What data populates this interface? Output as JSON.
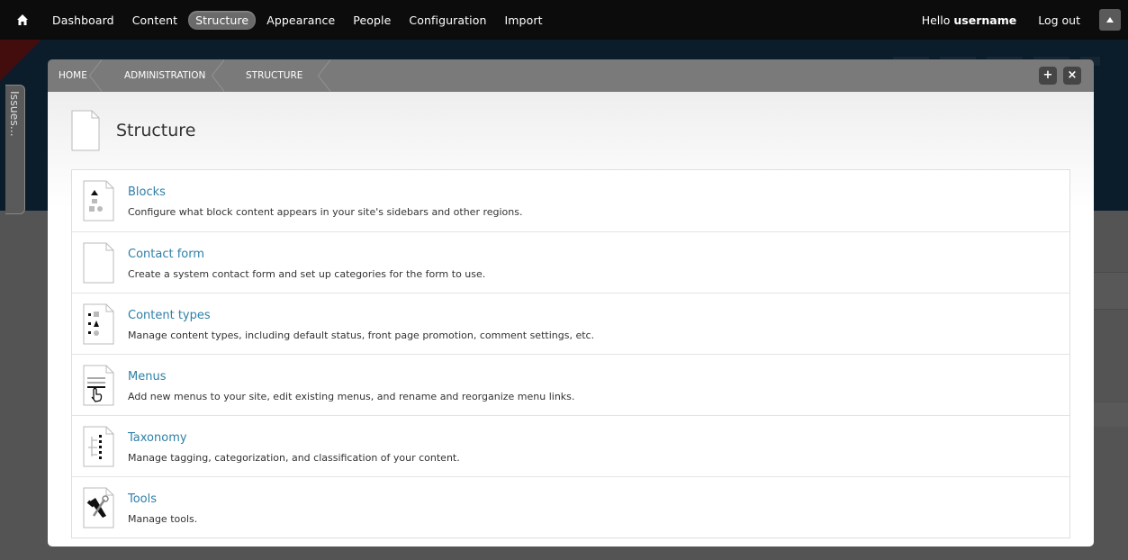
{
  "toolbar": {
    "menu": [
      {
        "label": "Dashboard"
      },
      {
        "label": "Content"
      },
      {
        "label": "Structure",
        "active": true
      },
      {
        "label": "Appearance"
      },
      {
        "label": "People"
      },
      {
        "label": "Configuration"
      },
      {
        "label": "Import"
      }
    ],
    "hello_prefix": "Hello",
    "username": "username",
    "logout_label": "Log out"
  },
  "side_tab": {
    "label": "Issues..."
  },
  "overlay": {
    "breadcrumb": [
      "HOME",
      "ADMINISTRATION",
      "STRUCTURE"
    ],
    "add_label": "+",
    "close_label": "×",
    "page_title": "Structure",
    "items": [
      {
        "title": "Blocks",
        "description": "Configure what block content appears in your site's sidebars and other regions.",
        "icon": "blocks-icon"
      },
      {
        "title": "Contact form",
        "description": "Create a system contact form and set up categories for the form to use.",
        "icon": "contact-form-icon"
      },
      {
        "title": "Content types",
        "description": "Manage content types, including default status, front page promotion, comment settings, etc.",
        "icon": "content-types-icon"
      },
      {
        "title": "Menus",
        "description": "Add new menus to your site, edit existing menus, and rename and reorganize menu links.",
        "icon": "menus-icon"
      },
      {
        "title": "Taxonomy",
        "description": "Manage tagging, categorization, and classification of your content.",
        "icon": "taxonomy-icon"
      },
      {
        "title": "Tools",
        "description": "Manage tools.",
        "icon": "tools-icon"
      }
    ]
  },
  "colors": {
    "toolbar_bg": "#0c0c0c",
    "active_tab_bg": "#6a6a6a",
    "overlay_header_bg": "#7a7a7a",
    "link": "#2f7fa8"
  }
}
